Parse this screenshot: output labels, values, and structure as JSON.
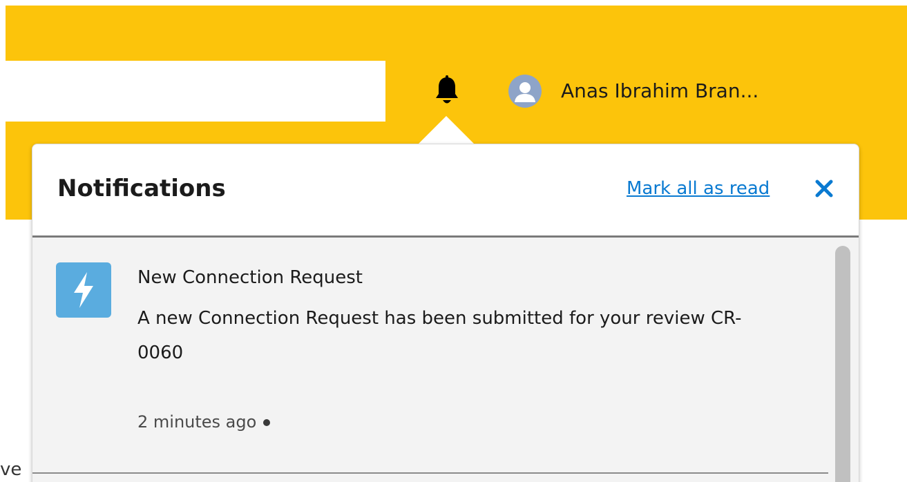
{
  "header": {
    "search": {
      "value": "",
      "placeholder": ""
    },
    "icons": {
      "notifications": "bell-icon",
      "avatar": "user-avatar-icon"
    },
    "user_name": "Anas Ibrahim Bran..."
  },
  "page": {
    "partial_text": "ve"
  },
  "notifications_panel": {
    "title": "Notifications",
    "mark_all_read_label": "Mark all as read",
    "close_icon": "close-icon",
    "items": [
      {
        "icon": "lightning-bolt-icon",
        "title": "New Connection Request",
        "body": "A new Connection Request has been submitted for your review CR-0060",
        "time": "2 minutes ago",
        "unread": true
      }
    ]
  },
  "colors": {
    "header_bg": "#fcc40b",
    "link": "#0a7ad1",
    "item_icon_bg": "#5aacdf",
    "list_bg": "#f3f3f3",
    "avatar_bg": "#8ea4c8"
  }
}
